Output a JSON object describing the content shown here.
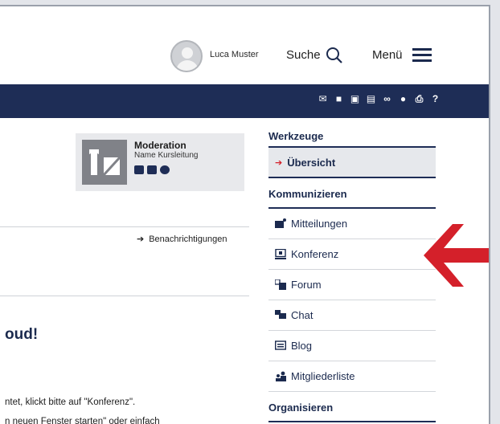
{
  "header": {
    "user_name": "Luca Muster",
    "search_label": "Suche",
    "menu_label": "Menü"
  },
  "toolbar": {
    "icons": [
      "mail-icon",
      "edit-icon",
      "screen-icon",
      "notes-icon",
      "link-icon",
      "location-icon",
      "print-icon",
      "help-icon"
    ],
    "help_glyph": "?"
  },
  "moderation": {
    "title": "Moderation",
    "subtitle": "Name Kursleitung",
    "icons": [
      "contact-card-icon",
      "mail-icon",
      "smiley-icon"
    ]
  },
  "content": {
    "notifications_link": "Benachrichtigungen",
    "heading_fragment": "oud!",
    "para1_fragment": "ntet, klickt bitte auf \"Konferenz\".",
    "para2_fragment": "n neuen Fenster starten\" oder einfach"
  },
  "sidebar": {
    "section_tools": "Werkzeuge",
    "overview": "Übersicht",
    "section_communicate": "Kommunizieren",
    "items": [
      {
        "label": "Mitteilungen",
        "icon": "messages-icon"
      },
      {
        "label": "Konferenz",
        "icon": "conference-icon"
      },
      {
        "label": "Forum",
        "icon": "forum-icon"
      },
      {
        "label": "Chat",
        "icon": "chat-icon"
      },
      {
        "label": "Blog",
        "icon": "blog-icon"
      },
      {
        "label": "Mitgliederliste",
        "icon": "members-icon"
      }
    ],
    "section_organize": "Organisieren"
  },
  "colors": {
    "navy": "#1e2d56",
    "accent_red": "#d4202a",
    "background": "#e3e5ea"
  }
}
